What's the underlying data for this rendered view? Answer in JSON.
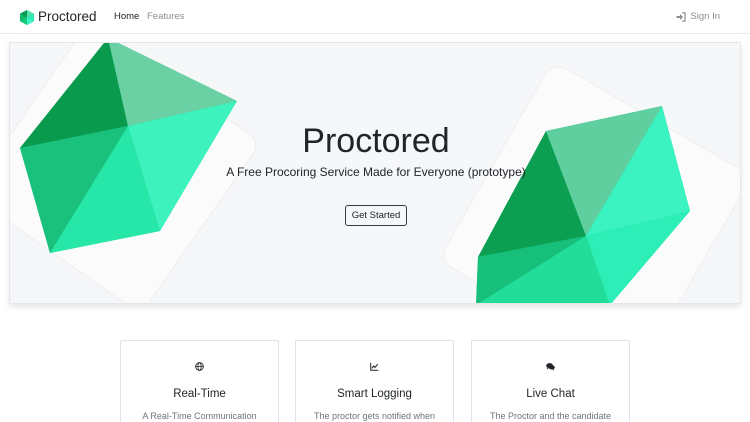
{
  "navbar": {
    "brand": "Proctored",
    "links": [
      {
        "label": "Home",
        "active": true
      },
      {
        "label": "Features",
        "active": false
      }
    ],
    "signin_label": "Sign In",
    "signin_icon": "sign-in-icon"
  },
  "hero": {
    "title": "Proctored",
    "subtitle": "A Free Procoring Service Made for Everyone (prototype)",
    "button_label": "Get Started"
  },
  "features": [
    {
      "icon": "globe-icon",
      "title": "Real-Time",
      "text": "A Real-Time Communication"
    },
    {
      "icon": "chart-icon",
      "title": "Smart Logging",
      "text": "The proctor gets notified when"
    },
    {
      "icon": "comments-icon",
      "title": "Live Chat",
      "text": "The Proctor and the candidate"
    }
  ],
  "colors": {
    "accent_dark": "#0a9a4e",
    "accent_light": "#33f5c0",
    "hero_bg": "#f6f7f9"
  }
}
